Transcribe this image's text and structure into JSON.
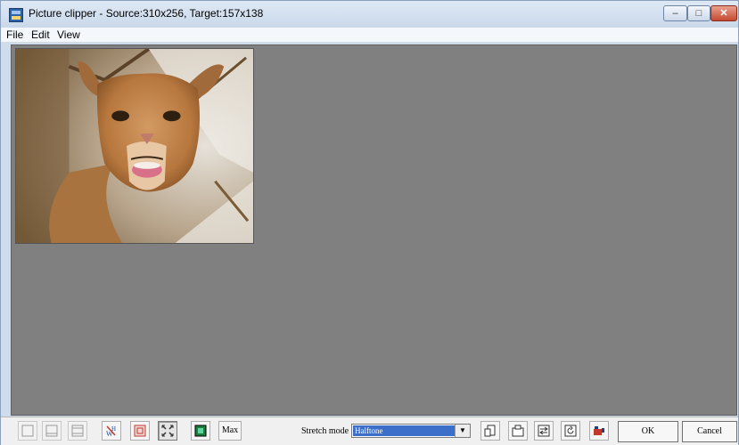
{
  "window": {
    "title": "Picture clipper - Source:310x256,  Target:157x138"
  },
  "titlebar_buttons": {
    "minimize": "–",
    "maximize": "□",
    "close": "✕"
  },
  "menu": {
    "items": [
      "File",
      "Edit",
      "View"
    ]
  },
  "toolbar": {
    "max_label": "Max",
    "stretch_mode_label": "Stretch mode",
    "stretch_mode_value": "Halftone",
    "select_arrow": "▼",
    "ok_label": "OK",
    "cancel_label": "Cancel"
  },
  "icons": [
    "app-icon",
    "frame-icon",
    "fit-width-icon",
    "fit-box-icon",
    "expand-icon",
    "color-swatch-icon",
    "rotate-icon",
    "camera-icon"
  ],
  "colors": {
    "canvas": "#808080",
    "selection": "#3b6fc9"
  }
}
